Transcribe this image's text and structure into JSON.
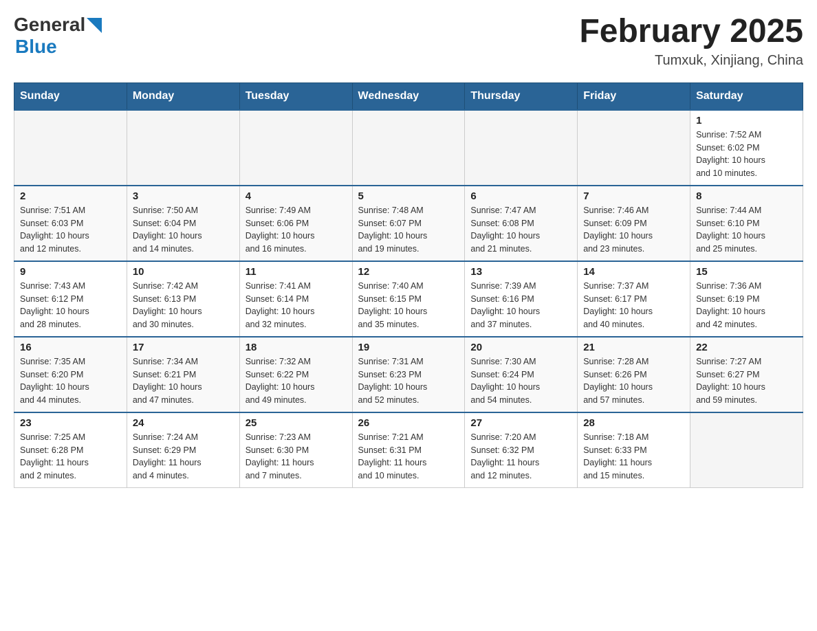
{
  "header": {
    "logo_general": "General",
    "logo_blue": "Blue",
    "title": "February 2025",
    "subtitle": "Tumxuk, Xinjiang, China"
  },
  "days_of_week": [
    "Sunday",
    "Monday",
    "Tuesday",
    "Wednesday",
    "Thursday",
    "Friday",
    "Saturday"
  ],
  "weeks": [
    [
      {
        "day": "",
        "info": ""
      },
      {
        "day": "",
        "info": ""
      },
      {
        "day": "",
        "info": ""
      },
      {
        "day": "",
        "info": ""
      },
      {
        "day": "",
        "info": ""
      },
      {
        "day": "",
        "info": ""
      },
      {
        "day": "1",
        "info": "Sunrise: 7:52 AM\nSunset: 6:02 PM\nDaylight: 10 hours\nand 10 minutes."
      }
    ],
    [
      {
        "day": "2",
        "info": "Sunrise: 7:51 AM\nSunset: 6:03 PM\nDaylight: 10 hours\nand 12 minutes."
      },
      {
        "day": "3",
        "info": "Sunrise: 7:50 AM\nSunset: 6:04 PM\nDaylight: 10 hours\nand 14 minutes."
      },
      {
        "day": "4",
        "info": "Sunrise: 7:49 AM\nSunset: 6:06 PM\nDaylight: 10 hours\nand 16 minutes."
      },
      {
        "day": "5",
        "info": "Sunrise: 7:48 AM\nSunset: 6:07 PM\nDaylight: 10 hours\nand 19 minutes."
      },
      {
        "day": "6",
        "info": "Sunrise: 7:47 AM\nSunset: 6:08 PM\nDaylight: 10 hours\nand 21 minutes."
      },
      {
        "day": "7",
        "info": "Sunrise: 7:46 AM\nSunset: 6:09 PM\nDaylight: 10 hours\nand 23 minutes."
      },
      {
        "day": "8",
        "info": "Sunrise: 7:44 AM\nSunset: 6:10 PM\nDaylight: 10 hours\nand 25 minutes."
      }
    ],
    [
      {
        "day": "9",
        "info": "Sunrise: 7:43 AM\nSunset: 6:12 PM\nDaylight: 10 hours\nand 28 minutes."
      },
      {
        "day": "10",
        "info": "Sunrise: 7:42 AM\nSunset: 6:13 PM\nDaylight: 10 hours\nand 30 minutes."
      },
      {
        "day": "11",
        "info": "Sunrise: 7:41 AM\nSunset: 6:14 PM\nDaylight: 10 hours\nand 32 minutes."
      },
      {
        "day": "12",
        "info": "Sunrise: 7:40 AM\nSunset: 6:15 PM\nDaylight: 10 hours\nand 35 minutes."
      },
      {
        "day": "13",
        "info": "Sunrise: 7:39 AM\nSunset: 6:16 PM\nDaylight: 10 hours\nand 37 minutes."
      },
      {
        "day": "14",
        "info": "Sunrise: 7:37 AM\nSunset: 6:17 PM\nDaylight: 10 hours\nand 40 minutes."
      },
      {
        "day": "15",
        "info": "Sunrise: 7:36 AM\nSunset: 6:19 PM\nDaylight: 10 hours\nand 42 minutes."
      }
    ],
    [
      {
        "day": "16",
        "info": "Sunrise: 7:35 AM\nSunset: 6:20 PM\nDaylight: 10 hours\nand 44 minutes."
      },
      {
        "day": "17",
        "info": "Sunrise: 7:34 AM\nSunset: 6:21 PM\nDaylight: 10 hours\nand 47 minutes."
      },
      {
        "day": "18",
        "info": "Sunrise: 7:32 AM\nSunset: 6:22 PM\nDaylight: 10 hours\nand 49 minutes."
      },
      {
        "day": "19",
        "info": "Sunrise: 7:31 AM\nSunset: 6:23 PM\nDaylight: 10 hours\nand 52 minutes."
      },
      {
        "day": "20",
        "info": "Sunrise: 7:30 AM\nSunset: 6:24 PM\nDaylight: 10 hours\nand 54 minutes."
      },
      {
        "day": "21",
        "info": "Sunrise: 7:28 AM\nSunset: 6:26 PM\nDaylight: 10 hours\nand 57 minutes."
      },
      {
        "day": "22",
        "info": "Sunrise: 7:27 AM\nSunset: 6:27 PM\nDaylight: 10 hours\nand 59 minutes."
      }
    ],
    [
      {
        "day": "23",
        "info": "Sunrise: 7:25 AM\nSunset: 6:28 PM\nDaylight: 11 hours\nand 2 minutes."
      },
      {
        "day": "24",
        "info": "Sunrise: 7:24 AM\nSunset: 6:29 PM\nDaylight: 11 hours\nand 4 minutes."
      },
      {
        "day": "25",
        "info": "Sunrise: 7:23 AM\nSunset: 6:30 PM\nDaylight: 11 hours\nand 7 minutes."
      },
      {
        "day": "26",
        "info": "Sunrise: 7:21 AM\nSunset: 6:31 PM\nDaylight: 11 hours\nand 10 minutes."
      },
      {
        "day": "27",
        "info": "Sunrise: 7:20 AM\nSunset: 6:32 PM\nDaylight: 11 hours\nand 12 minutes."
      },
      {
        "day": "28",
        "info": "Sunrise: 7:18 AM\nSunset: 6:33 PM\nDaylight: 11 hours\nand 15 minutes."
      },
      {
        "day": "",
        "info": ""
      }
    ]
  ]
}
